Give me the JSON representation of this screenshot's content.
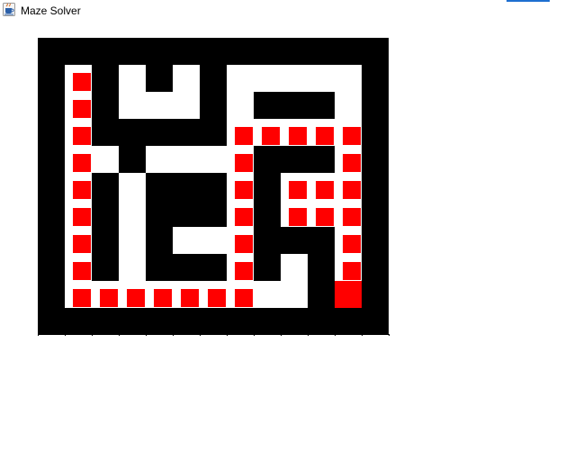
{
  "window": {
    "title": "Maze Solver",
    "icon": "java-coffee-cup-icon",
    "accent_color": "#1e6fd0"
  },
  "colors": {
    "wall": "#000000",
    "path": "#ffffff",
    "solution": "#ff0000"
  },
  "maze": {
    "rows": 11,
    "cols": 13,
    "legend": {
      "1": "wall",
      "0": "open",
      "2": "solution",
      "9": "goal"
    },
    "grid": [
      [
        1,
        1,
        1,
        1,
        1,
        1,
        1,
        1,
        1,
        1,
        1,
        1,
        1
      ],
      [
        1,
        2,
        1,
        0,
        1,
        0,
        1,
        0,
        0,
        0,
        0,
        0,
        1
      ],
      [
        1,
        2,
        1,
        0,
        0,
        0,
        1,
        0,
        1,
        1,
        1,
        0,
        1
      ],
      [
        1,
        2,
        1,
        1,
        1,
        1,
        1,
        2,
        2,
        2,
        2,
        2,
        1
      ],
      [
        1,
        2,
        0,
        1,
        0,
        0,
        0,
        2,
        1,
        1,
        1,
        2,
        1
      ],
      [
        1,
        2,
        1,
        0,
        1,
        1,
        1,
        2,
        1,
        2,
        2,
        2,
        1
      ],
      [
        1,
        2,
        1,
        0,
        1,
        1,
        1,
        2,
        1,
        2,
        2,
        2,
        1
      ],
      [
        1,
        2,
        1,
        0,
        1,
        0,
        0,
        2,
        1,
        1,
        1,
        2,
        1
      ],
      [
        1,
        2,
        1,
        0,
        1,
        1,
        1,
        2,
        1,
        0,
        1,
        2,
        1
      ],
      [
        1,
        2,
        2,
        2,
        2,
        2,
        2,
        2,
        0,
        0,
        1,
        9,
        1
      ],
      [
        1,
        1,
        1,
        1,
        1,
        1,
        1,
        1,
        1,
        1,
        1,
        1,
        1
      ]
    ]
  }
}
